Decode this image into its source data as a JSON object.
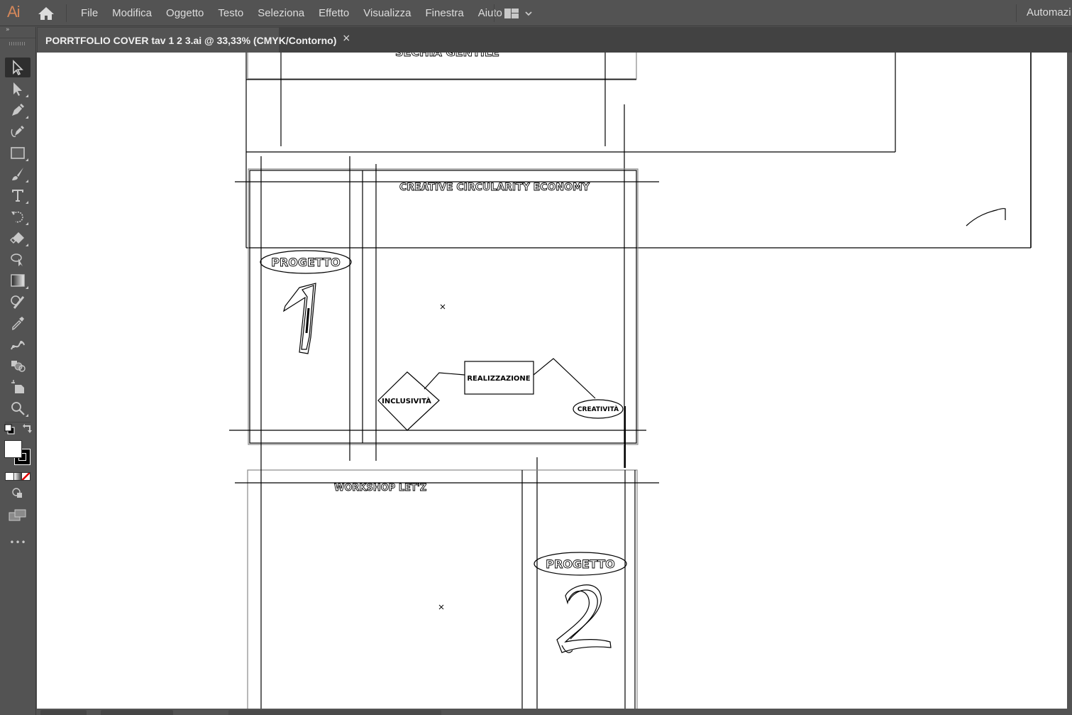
{
  "app": {
    "logo": "Ai",
    "home_icon": "home-icon",
    "menu": [
      "File",
      "Modifica",
      "Oggetto",
      "Testo",
      "Seleziona",
      "Effetto",
      "Visualizza",
      "Finestra",
      "Aiuto"
    ],
    "workspace_icon": "workspace-layout-icon",
    "right_label": "Automazi"
  },
  "document_tab": {
    "title": "PORRTFOLIO COVER tav 1 2 3.ai @ 33,33% (CMYK/Contorno)",
    "close": "×"
  },
  "toolbar": {
    "collapse": "»",
    "tools": [
      {
        "name": "selection-tool",
        "icon": "selection-arrow-icon",
        "active": true
      },
      {
        "name": "direct-selection-tool",
        "icon": "direct-selection-icon"
      },
      {
        "name": "pen-tool",
        "icon": "pen-icon"
      },
      {
        "name": "curvature-tool",
        "icon": "curvature-pen-icon"
      },
      {
        "name": "rectangle-tool",
        "icon": "rectangle-icon"
      },
      {
        "name": "paintbrush-tool",
        "icon": "paintbrush-icon"
      },
      {
        "name": "type-tool",
        "icon": "type-icon"
      },
      {
        "name": "rotate-tool",
        "icon": "rotate-icon"
      },
      {
        "name": "eraser-tool",
        "icon": "eraser-icon"
      },
      {
        "name": "puppet-warp-tool",
        "icon": "puppet-warp-icon"
      },
      {
        "name": "gradient-tool",
        "icon": "gradient-icon"
      },
      {
        "name": "shape-builder-tool",
        "icon": "shape-builder-icon"
      },
      {
        "name": "eyedropper-tool",
        "icon": "eyedropper-icon"
      },
      {
        "name": "blend-tool",
        "icon": "blend-icon"
      },
      {
        "name": "symbol-sprayer-tool",
        "icon": "symbol-sprayer-icon"
      },
      {
        "name": "artboard-tool",
        "icon": "artboard-icon"
      },
      {
        "name": "zoom-tool",
        "icon": "zoom-icon"
      }
    ],
    "fill_color": "#ffffff",
    "stroke_color": "#000000",
    "more": "•••"
  },
  "artwork": {
    "header_title_partial": "SECHIA GENTILE",
    "section1_title": "CREATIVE CIRCULARITY ECONOMY",
    "section1_badge": "PROGETTO",
    "section1_number": "1",
    "diagram_nodes": [
      "REALIZZAZIONE",
      "INCLUSIVITÀ",
      "CREATIVITÀ"
    ],
    "section2_title": "WORKSHOP LET'Z",
    "section2_badge": "PROGETTO",
    "section2_number": "2"
  },
  "colors": {
    "ui_bg": "#535353",
    "tabbar_bg": "#424242",
    "canvas_bg": "#ffffff",
    "logo_color": "#d4875a",
    "menu_text": "#dcdcdc"
  }
}
